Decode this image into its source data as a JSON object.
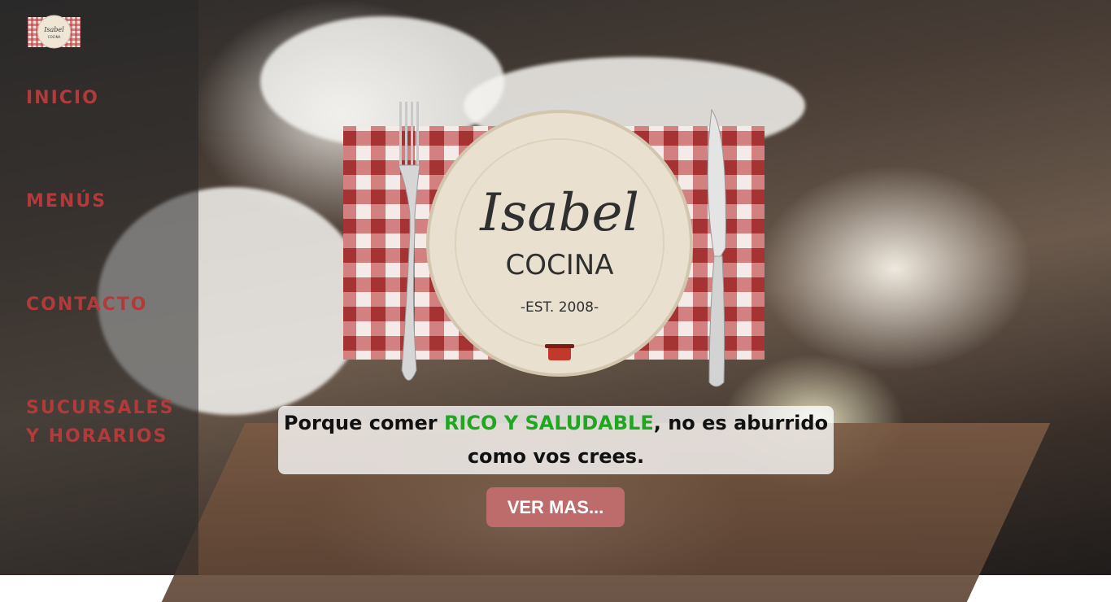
{
  "brand": {
    "script_name": "Isabel",
    "subtitle": "COCINA",
    "established": "-EST. 2008-"
  },
  "nav": {
    "items": [
      {
        "label": "INICIO"
      },
      {
        "label": "MENÚS"
      },
      {
        "label": "CONTACTO"
      },
      {
        "label": "SUCURSALES",
        "label2": "Y HORARIOS"
      }
    ]
  },
  "hero": {
    "tagline_prefix": "Porque comer ",
    "tagline_highlight": "RICO Y SALUDABLE",
    "tagline_suffix": ", no es aburrido",
    "tagline_line2": "como vos crees.",
    "button_label": "VER MAS..."
  },
  "colors": {
    "nav_text": "#b23a3a",
    "highlight": "#1fa81f",
    "button_bg": "#bd6b6b",
    "gingham_red": "#b52a2a"
  }
}
